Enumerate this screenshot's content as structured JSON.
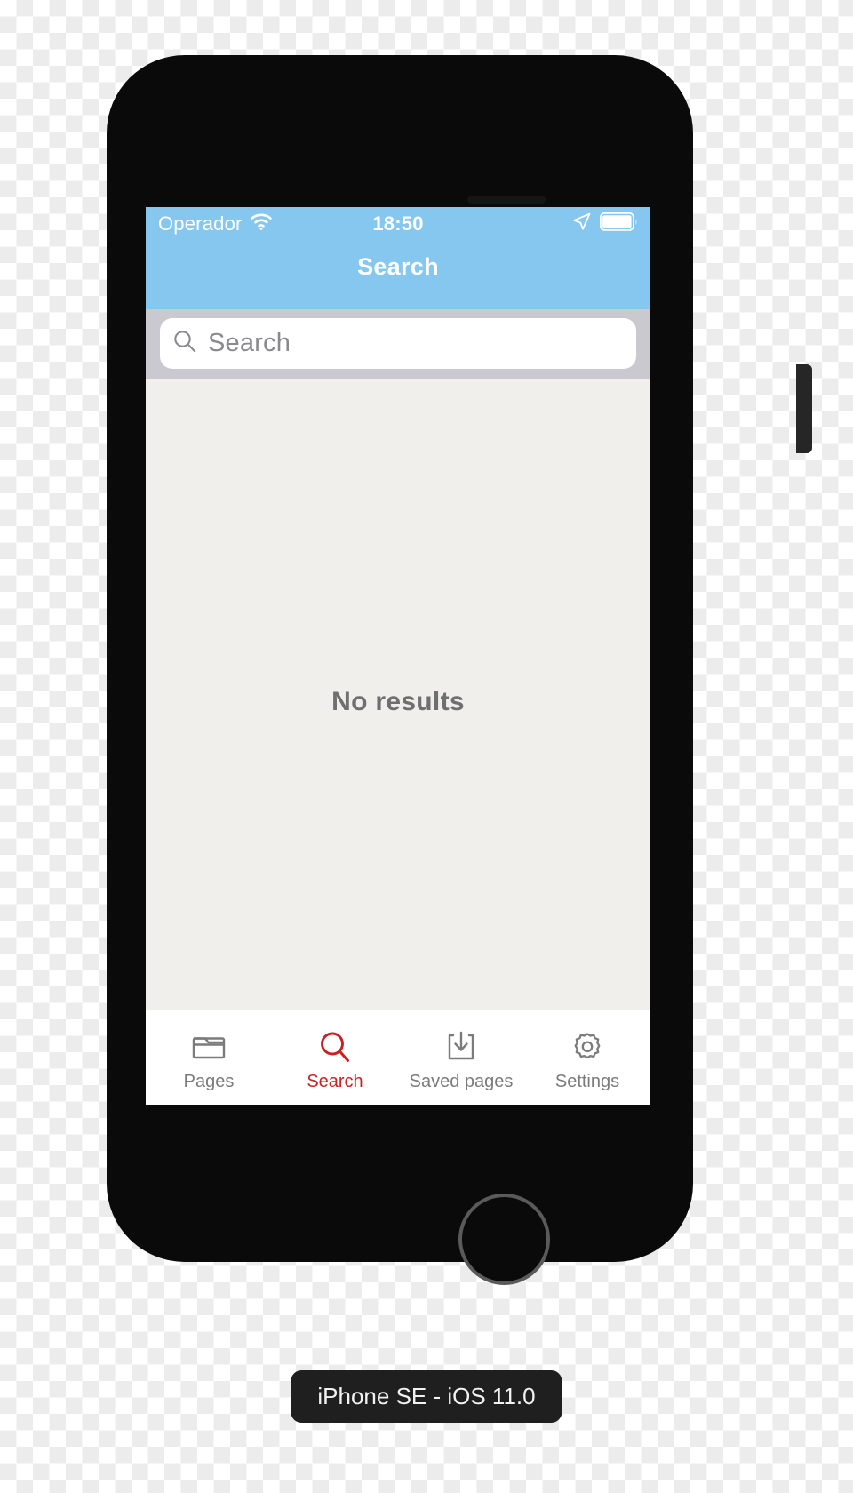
{
  "device": {
    "label": "iPhone SE - iOS 11.0",
    "accent_blue": "#85c7ef",
    "accent_red": "#cc2020",
    "body_color": "#0a0a0a",
    "screen_bg": "#f0efeb"
  },
  "status_bar": {
    "carrier": "Operador",
    "wifi_icon": "wifi-icon",
    "time": "18:50",
    "location_icon": "location-arrow-icon",
    "battery_icon": "battery-icon"
  },
  "nav_bar": {
    "title": "Search"
  },
  "search": {
    "placeholder": "Search",
    "value": "",
    "icon": "search-icon"
  },
  "content": {
    "empty_message": "No results"
  },
  "tab_bar": {
    "active_index": 1,
    "items": [
      {
        "label": "Pages",
        "icon": "folder-icon",
        "active": false
      },
      {
        "label": "Search",
        "icon": "search-icon",
        "active": true
      },
      {
        "label": "Saved pages",
        "icon": "download-icon",
        "active": false
      },
      {
        "label": "Settings",
        "icon": "gear-icon",
        "active": false
      }
    ]
  }
}
